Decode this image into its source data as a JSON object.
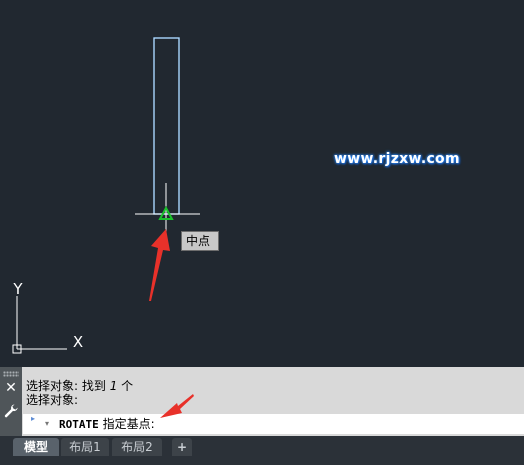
{
  "viewport": {
    "watermark": "www.rjzxw.com",
    "snap_tooltip": "中点",
    "ucs": {
      "y_label": "Y",
      "x_label": "X"
    }
  },
  "command_line": {
    "history": [
      {
        "prefix": "选择对象: 找到 ",
        "count": "1",
        "suffix": " 个"
      },
      {
        "text": "选择对象:"
      }
    ],
    "prompt_command": "ROTATE",
    "prompt_text": " 指定基点:",
    "close_glyph": "✕"
  },
  "layout_tabs": {
    "model": "模型",
    "layout1": "布局1",
    "layout2": "布局2",
    "add": "+"
  },
  "colors": {
    "canvas_bg": "#212830",
    "selection_outline": "#8ec9ff",
    "snap_marker": "#19c22b",
    "annotation_arrow": "#e8312a"
  }
}
